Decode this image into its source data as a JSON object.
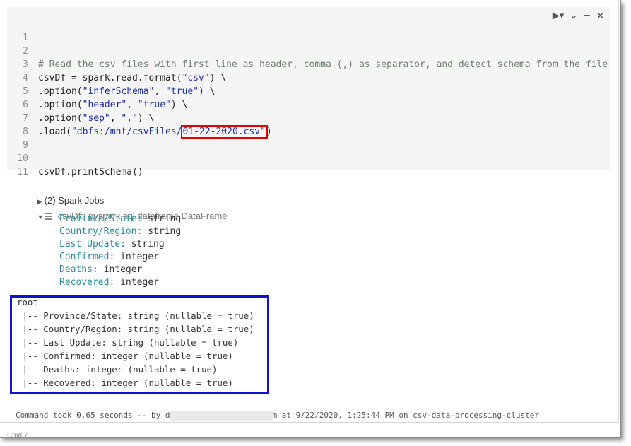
{
  "toolbar": {
    "run_icon": "▶▾",
    "collapse_icon": "⌄",
    "minimize_icon": "−",
    "close_icon": "×"
  },
  "code": {
    "line_numbers": [
      "1",
      "2",
      "3",
      "4",
      "5",
      "6",
      "7",
      "8",
      "9",
      "10",
      "11"
    ],
    "l2": "# Read the csv files with first line as header, comma (,) as separator, and detect schema from the file",
    "l3_a": "csvDf = spark.read.format(",
    "l3_s": "\"csv\"",
    "l3_b": ") \\",
    "l4_a": ".option(",
    "l4_s1": "\"inferSchema\"",
    "l4_m": ", ",
    "l4_s2": "\"true\"",
    "l4_b": ") \\",
    "l5_a": ".option(",
    "l5_s1": "\"header\"",
    "l5_m": ", ",
    "l5_s2": "\"true\"",
    "l5_b": ") \\",
    "l6_a": ".option(",
    "l6_s1": "\"sep\"",
    "l6_m": ", ",
    "l6_s2": "\",\"",
    "l6_b": ") \\",
    "l7_a": ".load(",
    "l7_s1": "\"dbfs:/mnt/csvFiles/",
    "l7_s2": "01-22-2020.csv\"",
    "l7_b": ")",
    "l10": "csvDf.printSchema()"
  },
  "output": {
    "spark_jobs": "(2) Spark Jobs",
    "df_name": "csvDf:",
    "df_type": "pyspark.sql.dataframe.DataFrame",
    "fields": [
      {
        "name": "Province/State:",
        "type": "string"
      },
      {
        "name": "Country/Region:",
        "type": "string"
      },
      {
        "name": "Last Update:",
        "type": "string"
      },
      {
        "name": "Confirmed:",
        "type": "integer"
      },
      {
        "name": "Deaths:",
        "type": "integer"
      },
      {
        "name": "Recovered:",
        "type": "integer"
      }
    ],
    "schema_lines": [
      "root",
      " |-- Province/State: string (nullable = true)",
      " |-- Country/Region: string (nullable = true)",
      " |-- Last Update: string (nullable = true)",
      " |-- Confirmed: integer (nullable = true)",
      " |-- Deaths: integer (nullable = true)",
      " |-- Recovered: integer (nullable = true)"
    ]
  },
  "footer": {
    "took_prefix": "Command took 0.65 seconds -- by d",
    "took_suffix": "m at 9/22/2020, 1:25:44 PM on csv-data-processing-cluster",
    "cmd_label": "Cmd 7"
  },
  "colors": {
    "highlight_red": "#e00000",
    "root_box_blue": "#1010d8",
    "string_blue": "#1f2fa4",
    "field_teal": "#2b8a9a"
  }
}
